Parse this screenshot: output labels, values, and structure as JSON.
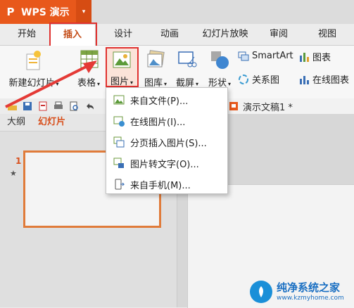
{
  "app": {
    "logo_letter": "P",
    "name": "WPS 演示",
    "menu_arrow": "▾"
  },
  "tabs": [
    "开始",
    "插入",
    "设计",
    "动画",
    "幻灯片放映",
    "审阅",
    "视图"
  ],
  "active_tab": "插入",
  "ribbon": {
    "new_slide": "新建幻灯片",
    "table": "表格",
    "picture": "图片",
    "gallery": "图库",
    "screenshot": "截屏",
    "shapes": "形状",
    "smartart": "SmartArt",
    "chart": "图表",
    "relation": "关系图",
    "online_chart": "在线图表",
    "caret": "▾"
  },
  "document": {
    "tab_title": "演示文稿1 *"
  },
  "panel": {
    "outline_tab": "大纲",
    "slides_tab": "幻灯片",
    "slide_number": "1",
    "star": "★"
  },
  "picture_menu": {
    "items": [
      {
        "label": "来自文件(P)...",
        "icon": "image-file-icon"
      },
      {
        "label": "在线图片(I)...",
        "icon": "online-image-icon"
      },
      {
        "label": "分页插入图片(S)...",
        "icon": "paged-insert-icon"
      },
      {
        "label": "图片转文字(O)...",
        "icon": "image-to-text-icon"
      },
      {
        "label": "来自手机(M)...",
        "icon": "phone-icon"
      }
    ]
  },
  "watermark": {
    "title": "纯净系统之家",
    "url": "www.kzmyhome.com"
  },
  "colors": {
    "accent": "#e8581b",
    "highlight_red": "#e0312f",
    "arrow_red": "#e43a36",
    "watermark_blue": "#1a8fd8"
  }
}
